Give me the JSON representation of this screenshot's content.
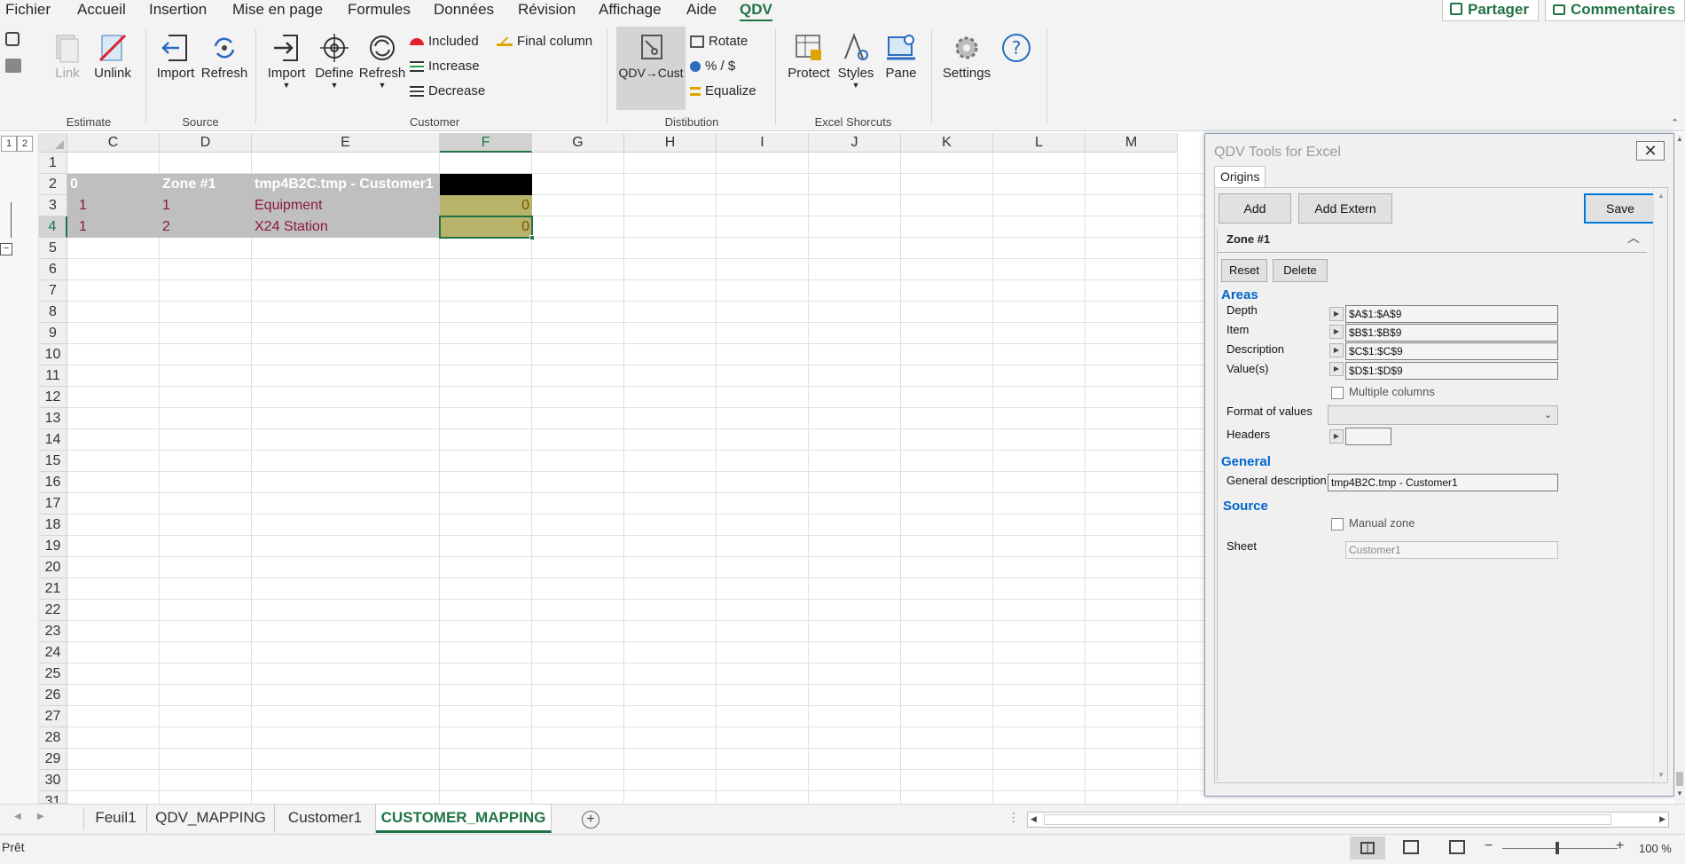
{
  "menu": {
    "items": [
      "Fichier",
      "Accueil",
      "Insertion",
      "Mise en page",
      "Formules",
      "Données",
      "Révision",
      "Affichage",
      "Aide",
      "QDV"
    ],
    "active": "QDV",
    "share_label": "Partager",
    "comments_label": "Commentaires"
  },
  "ribbon": {
    "estimate": {
      "label": "Estimate",
      "link": "Link",
      "unlink": "Unlink"
    },
    "source": {
      "label": "Source",
      "import": "Import",
      "refresh": "Refresh"
    },
    "customer": {
      "label": "Customer",
      "import": "Import",
      "define": "Define",
      "refresh": "Refresh",
      "included": "Included",
      "increase": "Increase",
      "decrease": "Decrease",
      "final_column": "Final column"
    },
    "distribution": {
      "label": "Distibution",
      "qdv_cust": "QDV→Cust",
      "rotate": "Rotate",
      "percent": "% / $",
      "equalize": "Equalize"
    },
    "shortcuts": {
      "label": "Excel Shorcuts",
      "protect": "Protect",
      "styles": "Styles",
      "pane": "Pane"
    },
    "settings": "Settings"
  },
  "sheet": {
    "columns": [
      "C",
      "D",
      "E",
      "F",
      "G",
      "H",
      "I",
      "J",
      "K",
      "L",
      "M"
    ],
    "selected_column": "F",
    "rows": [
      "1",
      "2",
      "3",
      "4",
      "5",
      "6",
      "7",
      "8",
      "9",
      "10",
      "11",
      "12",
      "13",
      "14",
      "15",
      "16",
      "17",
      "18",
      "19",
      "20",
      "21",
      "22",
      "23",
      "24",
      "25",
      "26",
      "27",
      "28",
      "29",
      "30",
      "31"
    ],
    "selected_row": "4",
    "outline_levels": [
      "1",
      "2"
    ],
    "header_row": {
      "c": "0",
      "d": "Zone #1",
      "e": "tmp4B2C.tmp - Customer1"
    },
    "data_rows": [
      {
        "c": "1",
        "d": "1",
        "e": "Equipment",
        "f": "0"
      },
      {
        "c": "1",
        "d": "2",
        "e": "X24 Station",
        "f": "0"
      }
    ]
  },
  "tabs": {
    "items": [
      "Feuil1",
      "QDV_MAPPING",
      "Customer1",
      "CUSTOMER_MAPPING"
    ],
    "active": "CUSTOMER_MAPPING"
  },
  "status": {
    "ready": "Prêt",
    "zoom": "100 %"
  },
  "pane": {
    "title": "QDV Tools for Excel",
    "tab": "Origins",
    "add": "Add",
    "add_extern": "Add Extern",
    "save": "Save",
    "zone_title": "Zone #1",
    "reset": "Reset",
    "delete": "Delete",
    "areas_label": "Areas",
    "depth_label": "Depth",
    "depth_value": "$A$1:$A$9",
    "item_label": "Item",
    "item_value": "$B$1:$B$9",
    "description_label": "Description",
    "description_value": "$C$1:$C$9",
    "values_label": "Value(s)",
    "values_value": "$D$1:$D$9",
    "multiple_columns": "Multiple columns",
    "format_label": "Format of values",
    "headers_label": "Headers",
    "general_label": "General",
    "general_desc_label": "General description",
    "general_desc_value": "tmp4B2C.tmp - Customer1",
    "source_label": "Source",
    "manual_zone": "Manual zone",
    "sheet_label": "Sheet",
    "sheet_value": "Customer1"
  },
  "colors": {
    "accent": "#217346",
    "header_fill": "#bfbfbf",
    "black_fill": "#000000",
    "value_fill": "#b8b36a",
    "data_text": "#8b1a3a",
    "pane_section": "#0066cc"
  }
}
